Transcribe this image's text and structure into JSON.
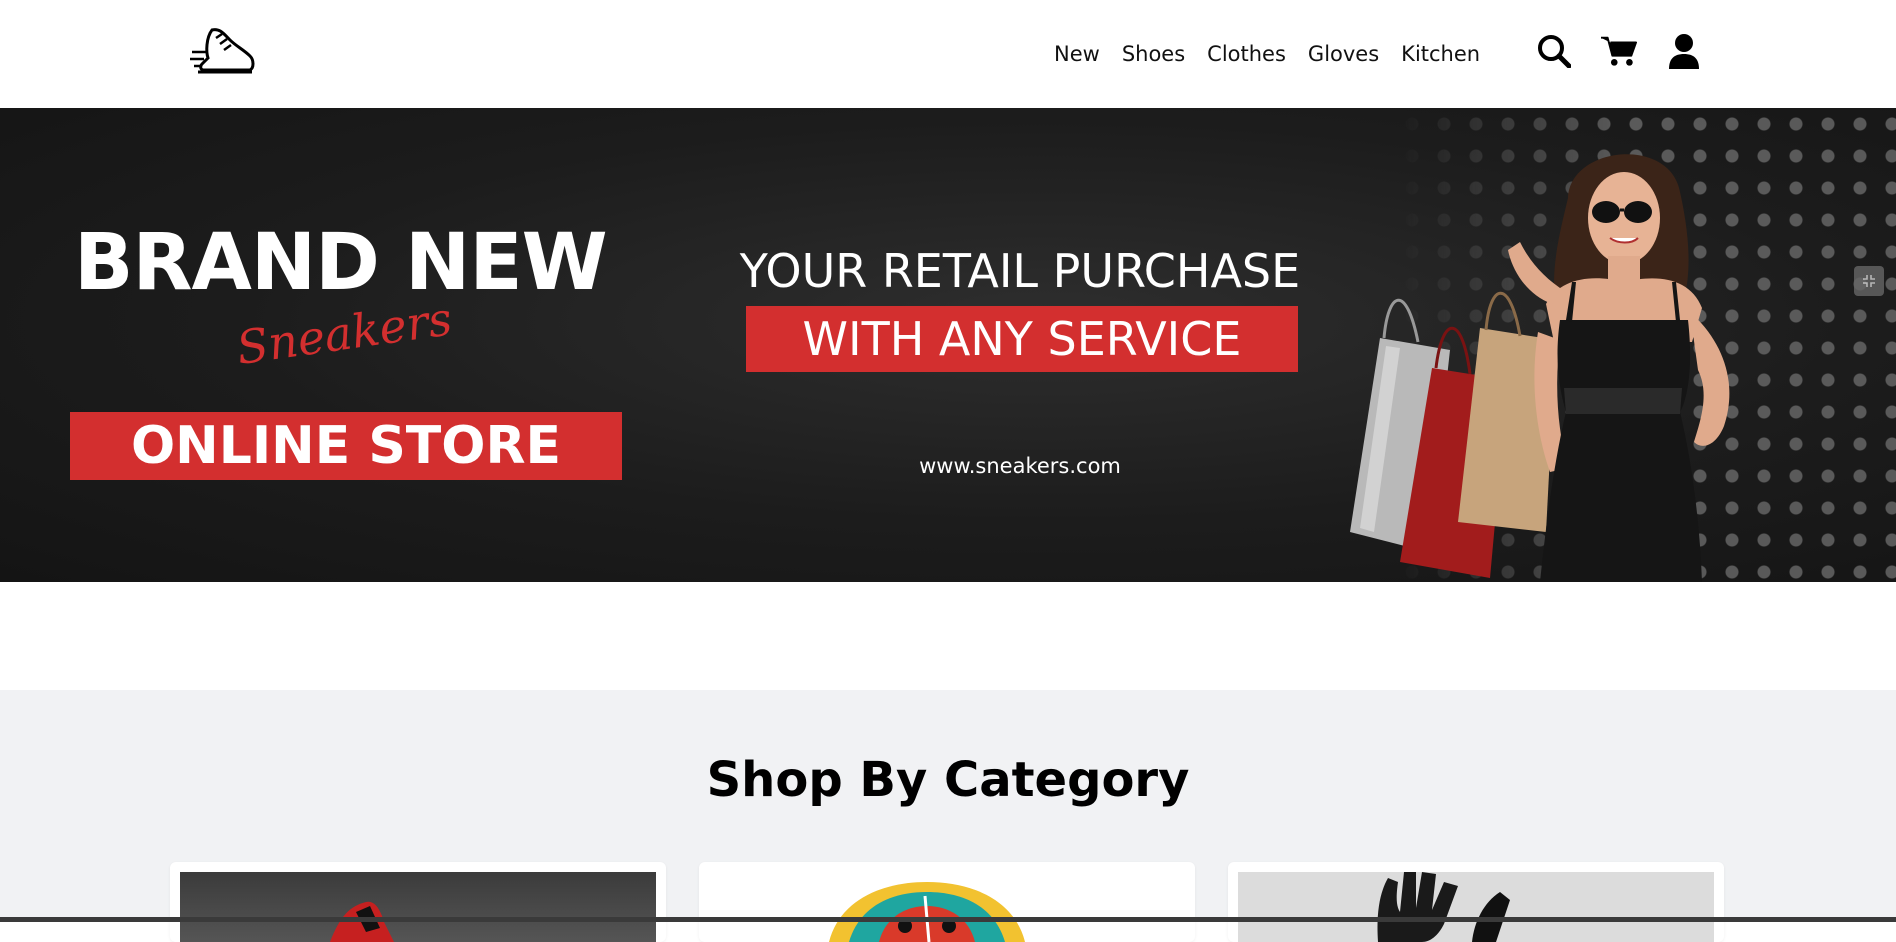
{
  "header": {
    "nav": [
      "New",
      "Shoes",
      "Clothes",
      "Gloves",
      "Kitchen"
    ],
    "icons": [
      "sneaker-logo-icon",
      "search-icon",
      "cart-icon",
      "user-icon"
    ]
  },
  "hero": {
    "headline": "BRAND NEW",
    "script": "Sneakers",
    "store_label": "ONLINE STORE",
    "tagline": "YOUR RETAIL PURCHASE",
    "service_label": "WITH ANY SERVICE",
    "url": "www.sneakers.com",
    "colors": {
      "accent": "#d32f2f",
      "background": "#1c1c1c"
    }
  },
  "categories": {
    "title": "Shop By Category",
    "cards": [
      {
        "image": "red-sneaker-thumbnail"
      },
      {
        "image": "graffiti-print-thumbnail"
      },
      {
        "image": "black-glove-thumbnail"
      }
    ]
  }
}
